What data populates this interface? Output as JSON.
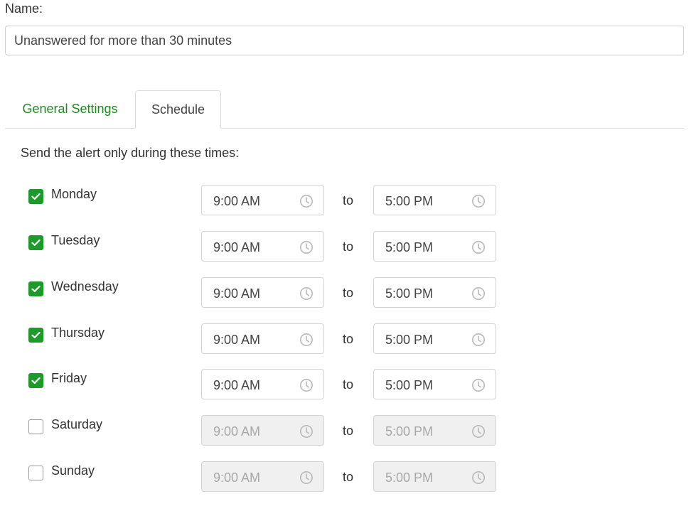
{
  "name_field": {
    "label": "Name:",
    "value": "Unanswered for more than 30 minutes"
  },
  "tabs": [
    {
      "label": "General Settings",
      "active": false
    },
    {
      "label": "Schedule",
      "active": true
    }
  ],
  "instructions": "Send the alert only during these times:",
  "separator": "to",
  "colors": {
    "accent": "#1e9a2a",
    "tab_link": "#1e8a1e",
    "disabled_bg": "#f0f0f0"
  },
  "schedule": [
    {
      "day": "Monday",
      "checked": true,
      "start": "9:00 AM",
      "end": "5:00 PM"
    },
    {
      "day": "Tuesday",
      "checked": true,
      "start": "9:00 AM",
      "end": "5:00 PM"
    },
    {
      "day": "Wednesday",
      "checked": true,
      "start": "9:00 AM",
      "end": "5:00 PM"
    },
    {
      "day": "Thursday",
      "checked": true,
      "start": "9:00 AM",
      "end": "5:00 PM"
    },
    {
      "day": "Friday",
      "checked": true,
      "start": "9:00 AM",
      "end": "5:00 PM"
    },
    {
      "day": "Saturday",
      "checked": false,
      "start": "9:00 AM",
      "end": "5:00 PM"
    },
    {
      "day": "Sunday",
      "checked": false,
      "start": "9:00 AM",
      "end": "5:00 PM"
    }
  ]
}
